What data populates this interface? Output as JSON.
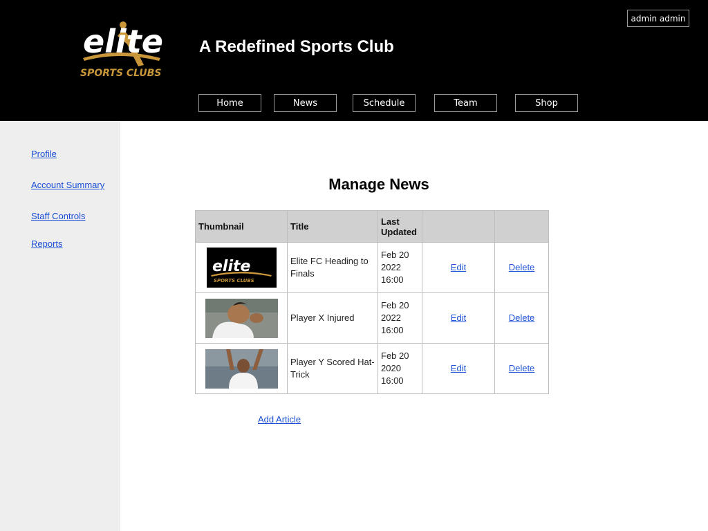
{
  "header": {
    "site_title": "A Redefined Sports Club",
    "logo_word": "elite",
    "logo_sub": "SPORTS CLUBS",
    "user_label": "admin admin",
    "nav": [
      "Home",
      "News",
      "Schedule",
      "Team",
      "Shop"
    ]
  },
  "sidebar": {
    "items": [
      "Profile",
      "Account Summary",
      "Staff Controls",
      "Reports"
    ]
  },
  "main": {
    "heading": "Manage News",
    "columns": [
      "Thumbnail",
      "Title",
      "Last Updated",
      "",
      ""
    ],
    "rows": [
      {
        "thumbnail": "elite-logo-thumbnail",
        "title": "Elite FC Heading to Finals",
        "date": "Feb 20",
        "year": "2022",
        "time": "16:00",
        "edit": "Edit",
        "delete": "Delete"
      },
      {
        "thumbnail": "injured-player-photo",
        "title": "Player X Injured",
        "date": "Feb 20",
        "year": "2022",
        "time": "16:00",
        "edit": "Edit",
        "delete": "Delete"
      },
      {
        "thumbnail": "celebrating-player-photo",
        "title": "Player Y Scored Hat-Trick",
        "date": "Feb 20",
        "year": "2020",
        "time": "16:00",
        "edit": "Edit",
        "delete": "Delete"
      }
    ],
    "add_label": "Add Article"
  },
  "colors": {
    "header_bg": "#000000",
    "sidebar_bg": "#eeeeee",
    "logo_gold": "#c9973a",
    "link": "#1a4fd6"
  }
}
